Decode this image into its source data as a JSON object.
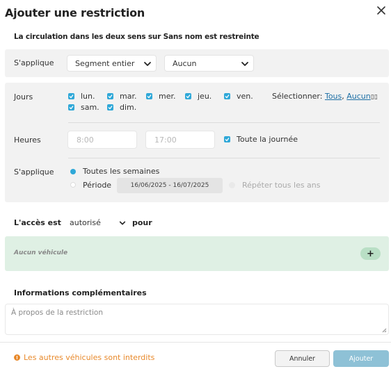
{
  "dialog": {
    "title": "Ajouter une restriction",
    "subtitle": "La circulation dans les deux sens sur Sans nom est restreinte"
  },
  "applies_row": {
    "label": "S'applique",
    "segment_select": "Segment entier",
    "lane_select": "Aucun"
  },
  "schedule": {
    "days_label": "Jours",
    "days": [
      {
        "label": "lun.",
        "checked": true
      },
      {
        "label": "mar.",
        "checked": true
      },
      {
        "label": "mer.",
        "checked": true
      },
      {
        "label": "jeu.",
        "checked": true
      },
      {
        "label": "ven.",
        "checked": true
      },
      {
        "label": "sam.",
        "checked": true
      },
      {
        "label": "dim.",
        "checked": true
      }
    ],
    "select_label": "Sélectionner:",
    "select_all": "Tous",
    "select_none": "Aucun",
    "select_trail": "▯▯",
    "hours_label": "Heures",
    "hours_from_placeholder": "8:00",
    "hours_to_placeholder": "17:00",
    "all_day_label": "Toute la journée",
    "all_day_checked": true,
    "applies_label": "S'applique",
    "option_weekly": "Toutes les semaines",
    "option_period": "Période",
    "selected_option": "weekly",
    "period_range": "16/06/2025 - 16/07/2025",
    "repeat_yearly": "Répéter tous les ans"
  },
  "access": {
    "label": "L'accès est",
    "value": "autorisé",
    "suffix": "pour"
  },
  "vehicles": {
    "empty_text": "Aucun véhicule",
    "add_symbol": "+"
  },
  "info": {
    "heading": "Informations complémentaires",
    "placeholder": "À propos de la restriction"
  },
  "footer": {
    "warning": "Les autres véhicules sont interdits",
    "cancel": "Annuler",
    "submit": "Ajouter"
  },
  "colors": {
    "accent": "#2fa8d8",
    "warning": "#e8892b",
    "vehicle_panel": "#dff0e4",
    "submit_button": "#8ec1d6"
  }
}
